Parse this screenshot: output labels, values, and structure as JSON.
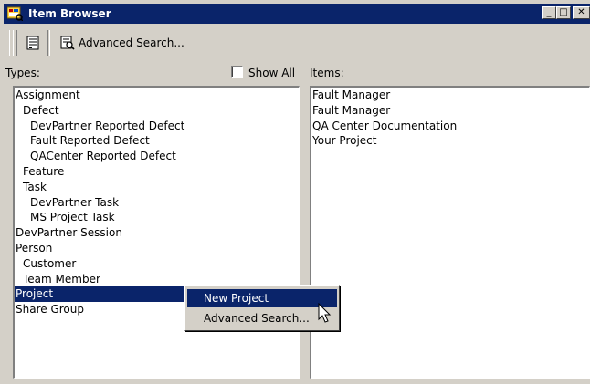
{
  "window": {
    "title": "Item Browser"
  },
  "title_buttons": {
    "minimize": "_",
    "maximize": "□",
    "close": "✕"
  },
  "toolbar": {
    "advanced_search_label": "Advanced Search..."
  },
  "types_panel": {
    "label": "Types:",
    "show_all_label": "Show All",
    "show_all_checked": false,
    "items": [
      {
        "label": "Assignment",
        "level": 0
      },
      {
        "label": "Defect",
        "level": 1
      },
      {
        "label": "DevPartner Reported Defect",
        "level": 2
      },
      {
        "label": "Fault Reported Defect",
        "level": 2
      },
      {
        "label": "QACenter Reported Defect",
        "level": 2
      },
      {
        "label": "Feature",
        "level": 1
      },
      {
        "label": "Task",
        "level": 1
      },
      {
        "label": "DevPartner Task",
        "level": 2
      },
      {
        "label": "MS Project Task",
        "level": 2
      },
      {
        "label": "DevPartner Session",
        "level": 0
      },
      {
        "label": "Person",
        "level": 0
      },
      {
        "label": "Customer",
        "level": 1
      },
      {
        "label": "Team Member",
        "level": 1
      },
      {
        "label": "Project",
        "level": 0,
        "selected": true
      },
      {
        "label": "Share Group",
        "level": 0
      }
    ]
  },
  "items_panel": {
    "label": "Items:",
    "items": [
      "Fault Manager",
      "Fault Manager",
      "QA Center Documentation",
      "Your Project"
    ]
  },
  "context_menu": {
    "items": [
      {
        "label": "New Project",
        "highlighted": true
      },
      {
        "label": "Advanced Search...",
        "highlighted": false
      }
    ]
  },
  "colors": {
    "titlebar": "#0a246a",
    "face": "#d4d0c8",
    "selection": "#0a246a"
  }
}
